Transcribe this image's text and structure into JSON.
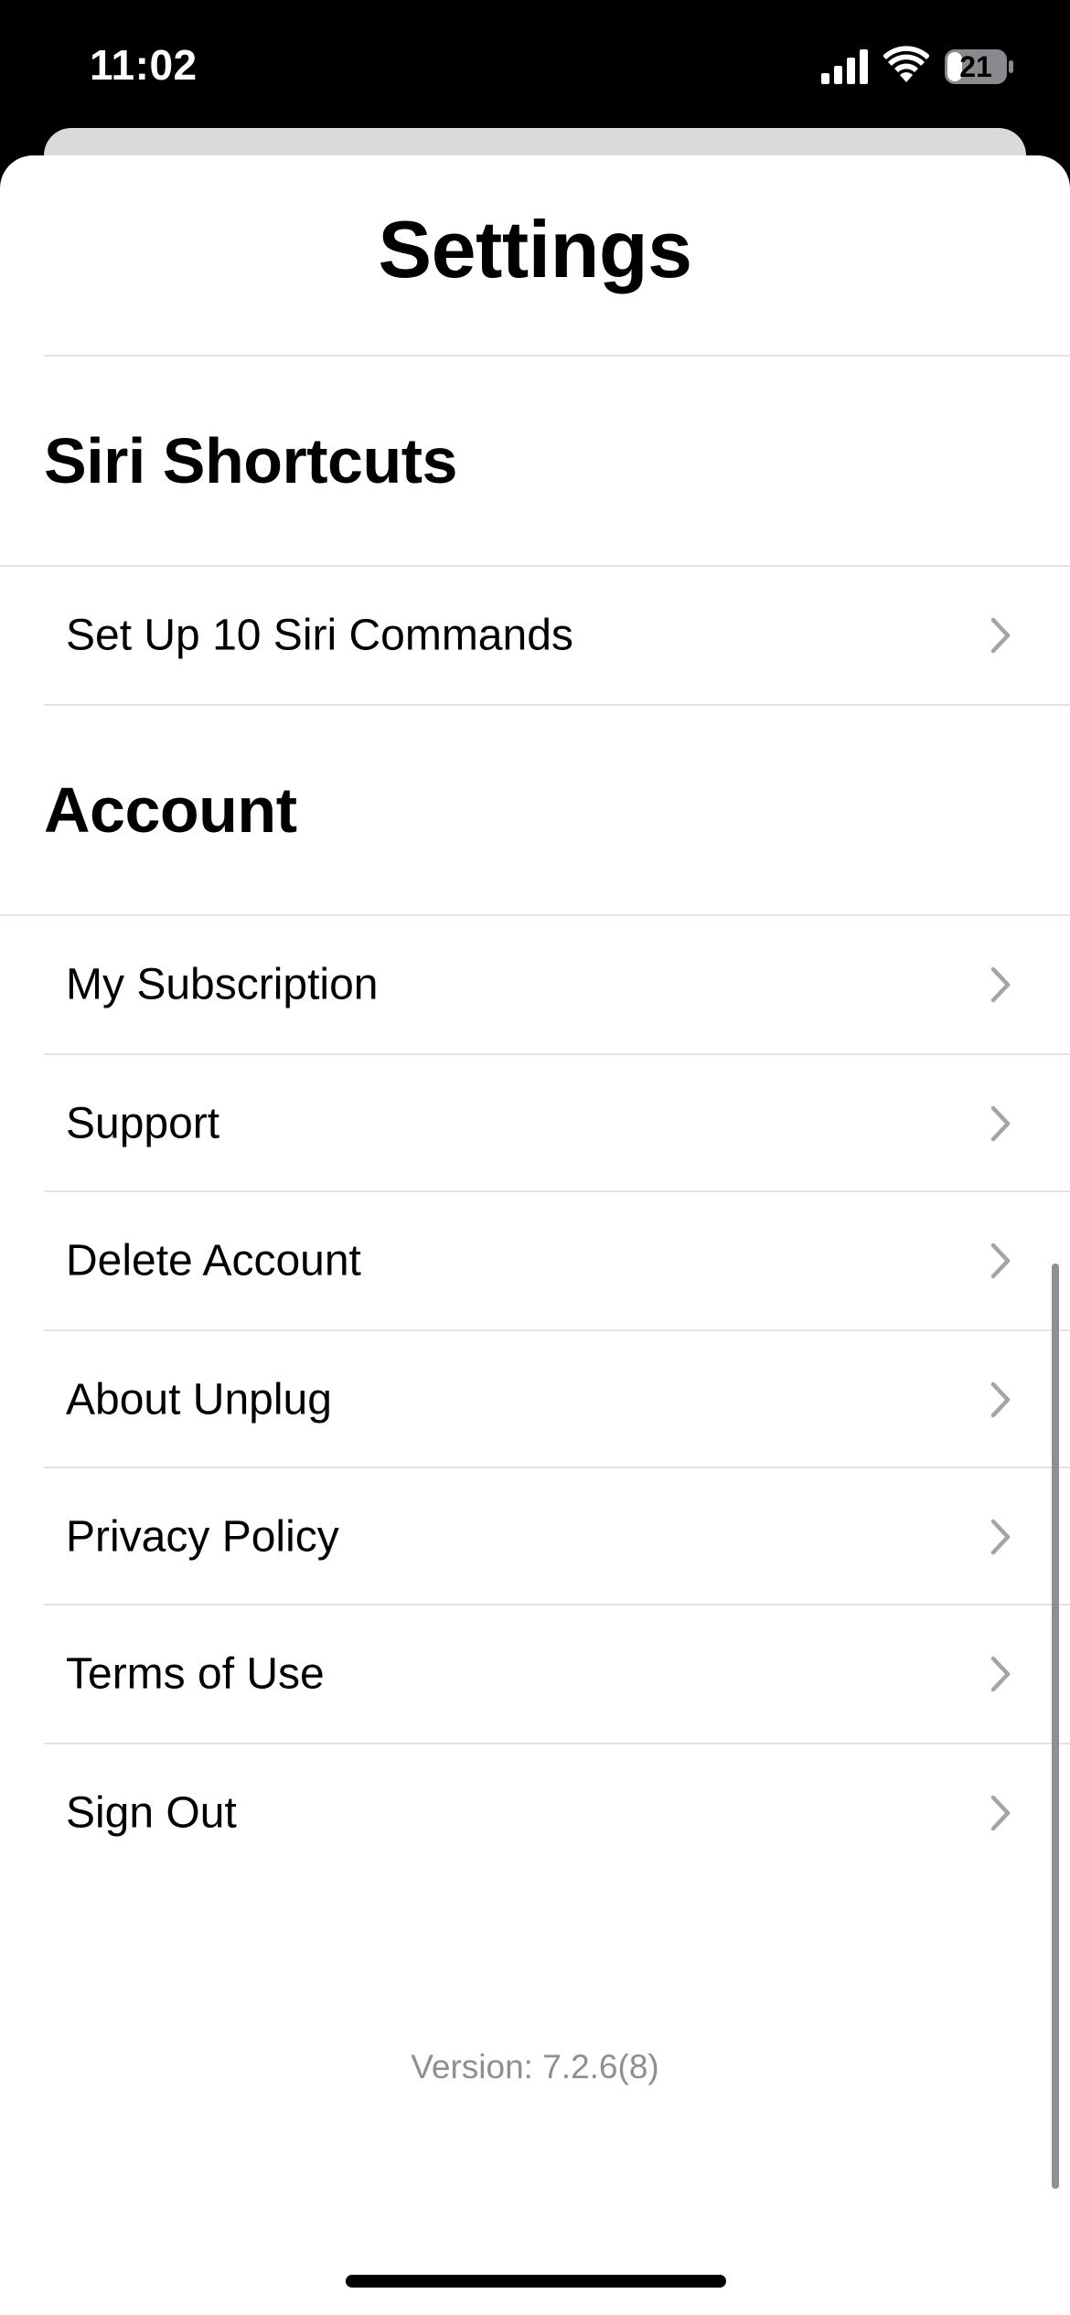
{
  "status_bar": {
    "time": "11:02",
    "battery_level": "21",
    "icons": [
      "signal-icon",
      "wifi-icon",
      "battery-icon"
    ]
  },
  "settings": {
    "title": "Settings",
    "sections": [
      {
        "header": "Siri Shortcuts",
        "items": [
          {
            "label": "Set Up 10 Siri Commands"
          }
        ]
      },
      {
        "header": "Account",
        "items": [
          {
            "label": "My Subscription"
          },
          {
            "label": "Support"
          },
          {
            "label": "Delete Account"
          },
          {
            "label": "About Unplug"
          },
          {
            "label": "Privacy Policy"
          },
          {
            "label": "Terms of Use"
          },
          {
            "label": "Sign Out"
          }
        ]
      }
    ],
    "version": "Version: 7.2.6(8)"
  },
  "colors": {
    "background": "#000000",
    "sheet": "#ffffff",
    "text": "#000000",
    "secondary_text": "#8e8e93",
    "chevron": "#a3a3a8",
    "divider": "#e3e3e6"
  }
}
